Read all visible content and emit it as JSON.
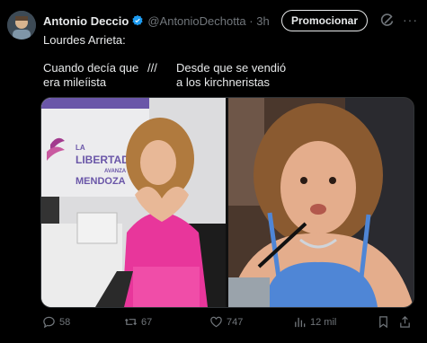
{
  "tweet": {
    "author_name": "Antonio Deccio",
    "handle_time": "@AntonioDechotta · 3h",
    "promote_label": "Promocionar",
    "more_label": "···",
    "line1": "Lourdes Arrieta:",
    "left_caption_1": "Cuando decía que",
    "left_caption_2": "era mileíista",
    "separator": "///",
    "right_caption_1": "Desde que se vendió",
    "right_caption_2": "a los kirchneristas"
  },
  "photo_left": {
    "banner_line1": "LA",
    "banner_line2": "LIBERTAD",
    "banner_line3": "AVANZA",
    "banner_line4": "MENDOZA"
  },
  "actions": {
    "replies": "58",
    "reposts": "67",
    "likes": "747",
    "views": "12 mil"
  },
  "colors": {
    "background": "#000000",
    "text": "#e7e9ea",
    "muted": "#71767b",
    "verified": "#1d9bf0"
  }
}
